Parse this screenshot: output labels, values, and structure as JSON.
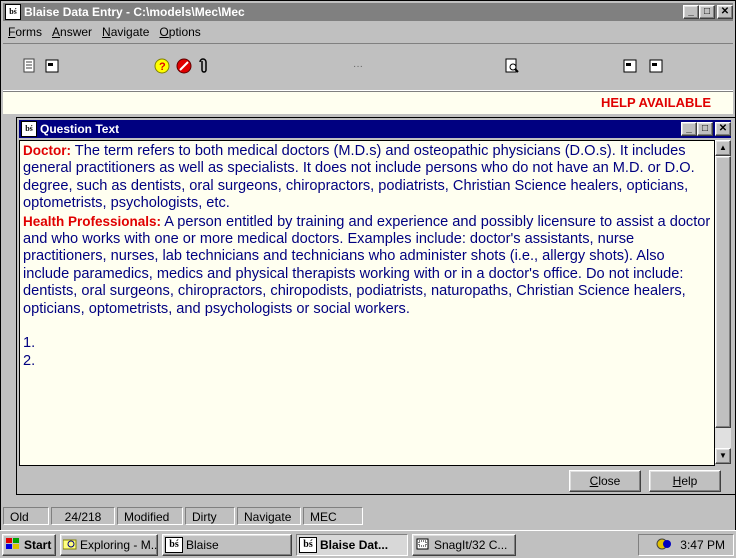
{
  "app": {
    "title": "Blaise Data Entry - C:\\models\\Mec\\Mec",
    "icon_text": "bś"
  },
  "menu": [
    {
      "label": "Forms",
      "key": "F",
      "rest": "orms"
    },
    {
      "label": "Answer",
      "key": "A",
      "rest": "nswer"
    },
    {
      "label": "Navigate",
      "key": "N",
      "rest": "avigate"
    },
    {
      "label": "Options",
      "key": "O",
      "rest": "ptions"
    }
  ],
  "toolbar": {
    "icons": [
      "document-icon",
      "form-icon",
      "help-question-icon",
      "stop-icon",
      "paperclip-icon",
      "dots-icon",
      "preview-icon",
      "form-icon",
      "form-icon"
    ],
    "dots_text": "···"
  },
  "help_available": "HELP AVAILABLE",
  "question_window": {
    "title": "Question Text",
    "doctor_term": "Doctor:",
    "doctor_text": " The term refers to both medical doctors (M.D.s) and osteopathic physicians (D.O.s). It includes general practitioners as well as specialists. It does not include persons who do not have an M.D. or D.O. degree, such as dentists, oral surgeons, chiropractors, podiatrists, Christian Science healers, opticians, optometrists, psychologists, etc.",
    "hp_term": "Health Professionals:",
    "hp_text": " A person entitled by training and experience and possibly licensure to assist a doctor and who works with one or more medical doctors. Examples include: doctor's assistants, nurse practitioners, nurses, lab technicians and technicians who administer shots (i.e., allergy shots). Also include paramedics, medics and physical therapists working with or in a doctor's office. Do not include: dentists, oral surgeons, chiropractors, chiropodists, podiatrists, naturopaths, Christian Science healers, opticians, optometrists, and psychologists or social workers.",
    "list_1": "1.",
    "list_2": "2.",
    "close_key": "C",
    "close_rest": "lose",
    "help_key": "H",
    "help_rest": "elp"
  },
  "status": {
    "cells": [
      "Old",
      "24/218",
      "Modified",
      "Dirty",
      "Navigate",
      "MEC"
    ]
  },
  "taskbar": {
    "start": "Start",
    "tasks": [
      "Exploring - M...",
      "Blaise",
      "Blaise Dat...",
      "SnagIt/32 C..."
    ],
    "clock": "3:47 PM"
  },
  "colors": {
    "title_active": "#000080",
    "title_inactive": "#808080",
    "help_red": "#e00000",
    "text_navy": "#000080",
    "note_bg": "#fffff0"
  }
}
